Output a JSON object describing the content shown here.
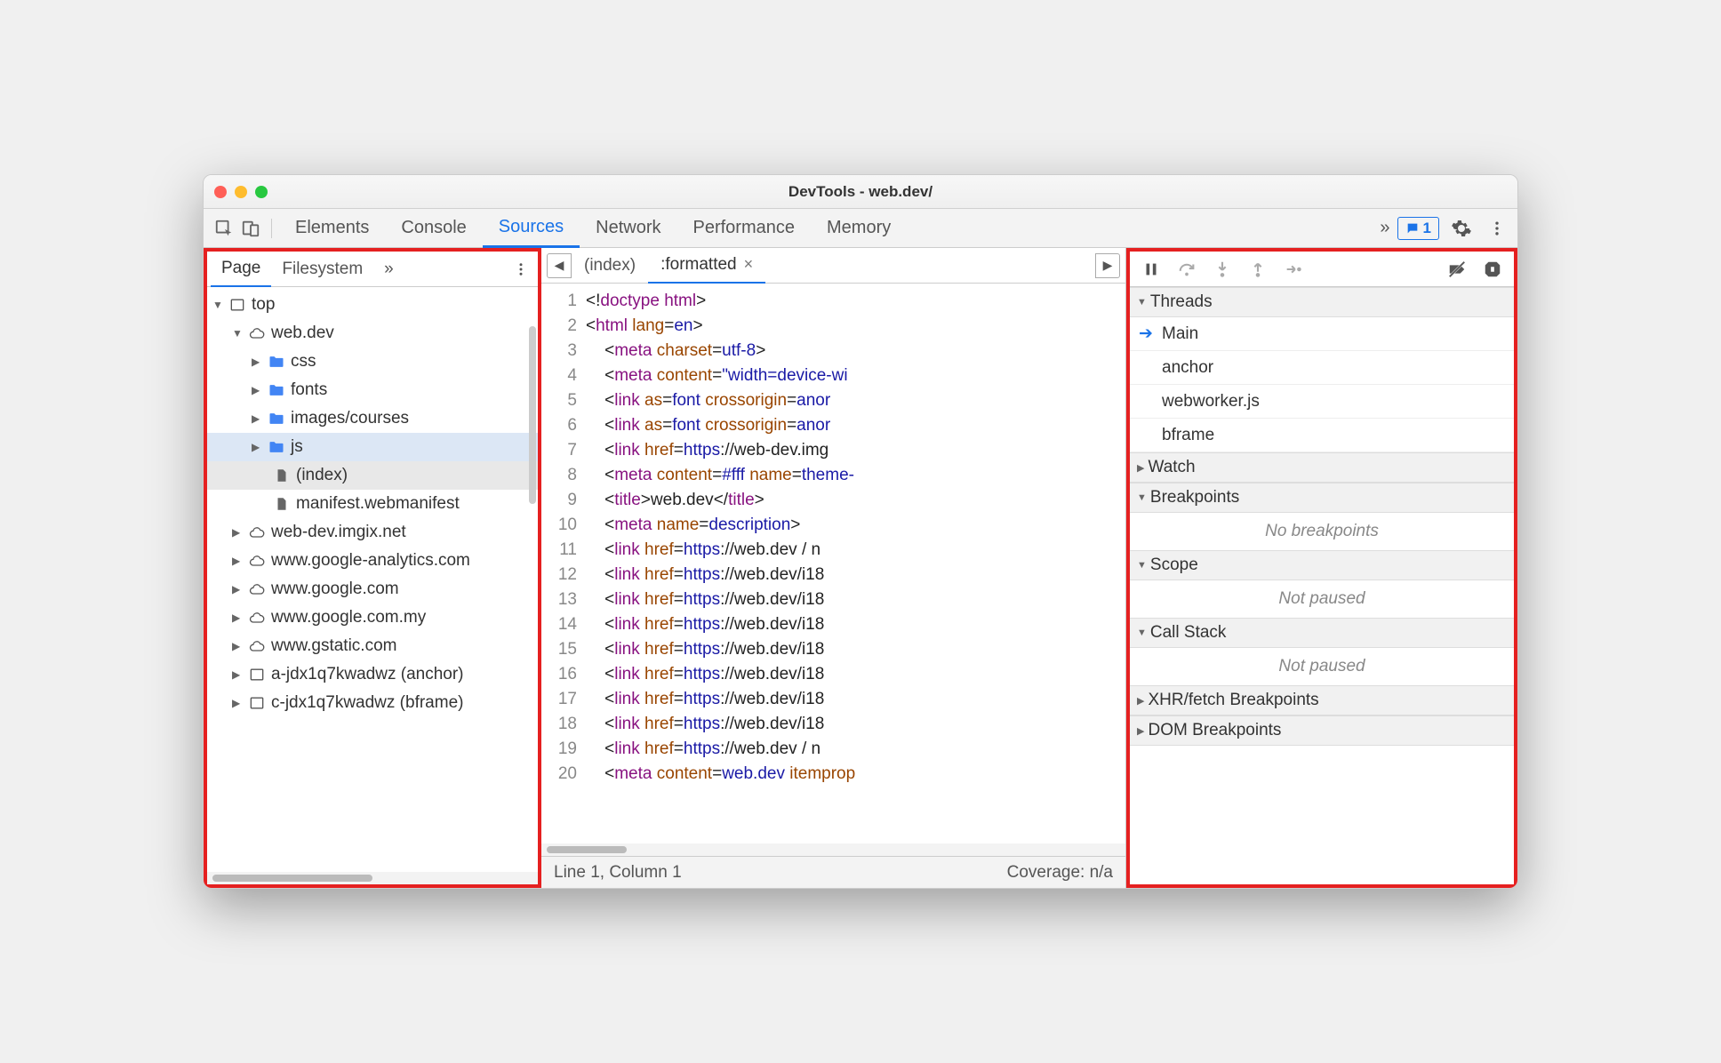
{
  "window": {
    "title": "DevTools - web.dev/"
  },
  "toolbar": {
    "tabs": [
      "Elements",
      "Console",
      "Sources",
      "Network",
      "Performance",
      "Memory"
    ],
    "active_tab": "Sources",
    "overflow": "»",
    "message_count": "1"
  },
  "left": {
    "tabs": [
      "Page",
      "Filesystem"
    ],
    "active_tab": "Page",
    "overflow": "»",
    "tree": [
      {
        "depth": 0,
        "expanded": true,
        "icon": "frame",
        "label": "top"
      },
      {
        "depth": 1,
        "expanded": true,
        "icon": "cloud",
        "label": "web.dev"
      },
      {
        "depth": 2,
        "expanded": false,
        "icon": "folder",
        "label": "css"
      },
      {
        "depth": 2,
        "expanded": false,
        "icon": "folder",
        "label": "fonts"
      },
      {
        "depth": 2,
        "expanded": false,
        "icon": "folder",
        "label": "images/courses"
      },
      {
        "depth": 2,
        "expanded": false,
        "icon": "folder",
        "label": "js",
        "selected": true
      },
      {
        "depth": 3,
        "expanded": null,
        "icon": "file",
        "label": "(index)",
        "selected2": true
      },
      {
        "depth": 3,
        "expanded": null,
        "icon": "file",
        "label": "manifest.webmanifest"
      },
      {
        "depth": 1,
        "expanded": false,
        "icon": "cloud",
        "label": "web-dev.imgix.net"
      },
      {
        "depth": 1,
        "expanded": false,
        "icon": "cloud",
        "label": "www.google-analytics.com"
      },
      {
        "depth": 1,
        "expanded": false,
        "icon": "cloud",
        "label": "www.google.com"
      },
      {
        "depth": 1,
        "expanded": false,
        "icon": "cloud",
        "label": "www.google.com.my"
      },
      {
        "depth": 1,
        "expanded": false,
        "icon": "cloud",
        "label": "www.gstatic.com"
      },
      {
        "depth": 1,
        "expanded": false,
        "icon": "frame",
        "label": "a-jdx1q7kwadwz (anchor)"
      },
      {
        "depth": 1,
        "expanded": false,
        "icon": "frame",
        "label": "c-jdx1q7kwadwz (bframe)"
      }
    ]
  },
  "center": {
    "tabs": [
      {
        "label": "(index)",
        "active": false,
        "closable": false
      },
      {
        "label": ":formatted",
        "active": true,
        "closable": true
      }
    ],
    "lines": [
      [
        "<!doctype html>"
      ],
      [
        "<",
        "html",
        " ",
        "lang",
        "=",
        "en",
        ">"
      ],
      [
        "    <",
        "meta",
        " ",
        "charset",
        "=",
        "utf-8",
        ">"
      ],
      [
        "    <",
        "meta",
        " ",
        "content",
        "=",
        "\"width=device-wi"
      ],
      [
        "    <",
        "link",
        " ",
        "as",
        "=",
        "font",
        " ",
        "crossorigin",
        "=",
        "anor"
      ],
      [
        "    <",
        "link",
        " ",
        "as",
        "=",
        "font",
        " ",
        "crossorigin",
        "=",
        "anor"
      ],
      [
        "    <",
        "link",
        " ",
        "href",
        "=",
        "https",
        ":",
        "//web-dev.img"
      ],
      [
        "    <",
        "meta",
        " ",
        "content",
        "=",
        "#fff",
        " ",
        "name",
        "=",
        "theme-"
      ],
      [
        "    <",
        "title",
        ">",
        "web.dev",
        "</",
        "title",
        ">"
      ],
      [
        "    <",
        "meta",
        " ",
        "name",
        "=",
        "description",
        ">"
      ],
      [
        "    <",
        "link",
        " ",
        "href",
        "=",
        "https",
        ":",
        "//web.dev / n"
      ],
      [
        "    <",
        "link",
        " ",
        "href",
        "=",
        "https",
        ":",
        "//web.dev/i18"
      ],
      [
        "    <",
        "link",
        " ",
        "href",
        "=",
        "https",
        ":",
        "//web.dev/i18"
      ],
      [
        "    <",
        "link",
        " ",
        "href",
        "=",
        "https",
        ":",
        "//web.dev/i18"
      ],
      [
        "    <",
        "link",
        " ",
        "href",
        "=",
        "https",
        ":",
        "//web.dev/i18"
      ],
      [
        "    <",
        "link",
        " ",
        "href",
        "=",
        "https",
        ":",
        "//web.dev/i18"
      ],
      [
        "    <",
        "link",
        " ",
        "href",
        "=",
        "https",
        ":",
        "//web.dev/i18"
      ],
      [
        "    <",
        "link",
        " ",
        "href",
        "=",
        "https",
        ":",
        "//web.dev/i18"
      ],
      [
        "    <",
        "link",
        " ",
        "href",
        "=",
        "https",
        ":",
        "//web.dev / n"
      ],
      [
        "    <",
        "meta",
        " ",
        "content",
        "=",
        "web.dev",
        " ",
        "itemprop"
      ]
    ],
    "status": {
      "position": "Line 1, Column 1",
      "coverage": "Coverage: n/a"
    }
  },
  "right": {
    "sections": {
      "threads": {
        "label": "Threads",
        "expanded": true,
        "items": [
          "Main",
          "anchor",
          "webworker.js",
          "bframe"
        ],
        "active": "Main"
      },
      "watch": {
        "label": "Watch",
        "expanded": false
      },
      "breakpoints": {
        "label": "Breakpoints",
        "expanded": true,
        "empty": "No breakpoints"
      },
      "scope": {
        "label": "Scope",
        "expanded": true,
        "empty": "Not paused"
      },
      "callstack": {
        "label": "Call Stack",
        "expanded": true,
        "empty": "Not paused"
      },
      "xhr": {
        "label": "XHR/fetch Breakpoints",
        "expanded": false
      },
      "dom": {
        "label": "DOM Breakpoints",
        "expanded": false
      }
    }
  }
}
